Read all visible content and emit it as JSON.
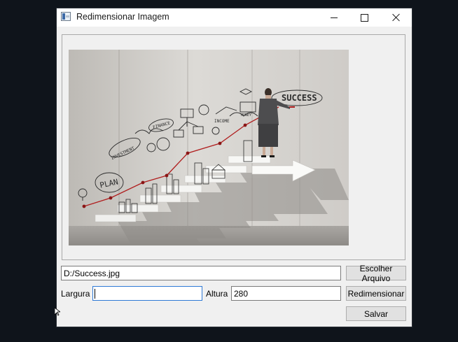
{
  "window": {
    "title": "Redimensionar Imagem",
    "icon": "app-icon"
  },
  "titlebar_buttons": {
    "minimize": "minimize-icon",
    "maximize": "maximize-icon",
    "close": "close-icon"
  },
  "image": {
    "overlay_text": {
      "success": "SUCCESS",
      "plan": "PLAN",
      "investment": "INVESTMENT",
      "finance": "FINANCE",
      "income": "INCOME",
      "money": "MONEY"
    }
  },
  "file": {
    "path_value": "D:/Success.jpg",
    "choose_button": "Escolher Arquivo"
  },
  "resize": {
    "width_label": "Largura",
    "width_value": "",
    "height_label": "Altura",
    "height_value": "280",
    "resize_button": "Redimensionar",
    "save_button": "Salvar"
  },
  "colors": {
    "window_bg": "#f0f0f0",
    "desktop_bg": "#0f141b",
    "focus_border": "#2f7ad6",
    "chart_line": "#b01e1e"
  }
}
